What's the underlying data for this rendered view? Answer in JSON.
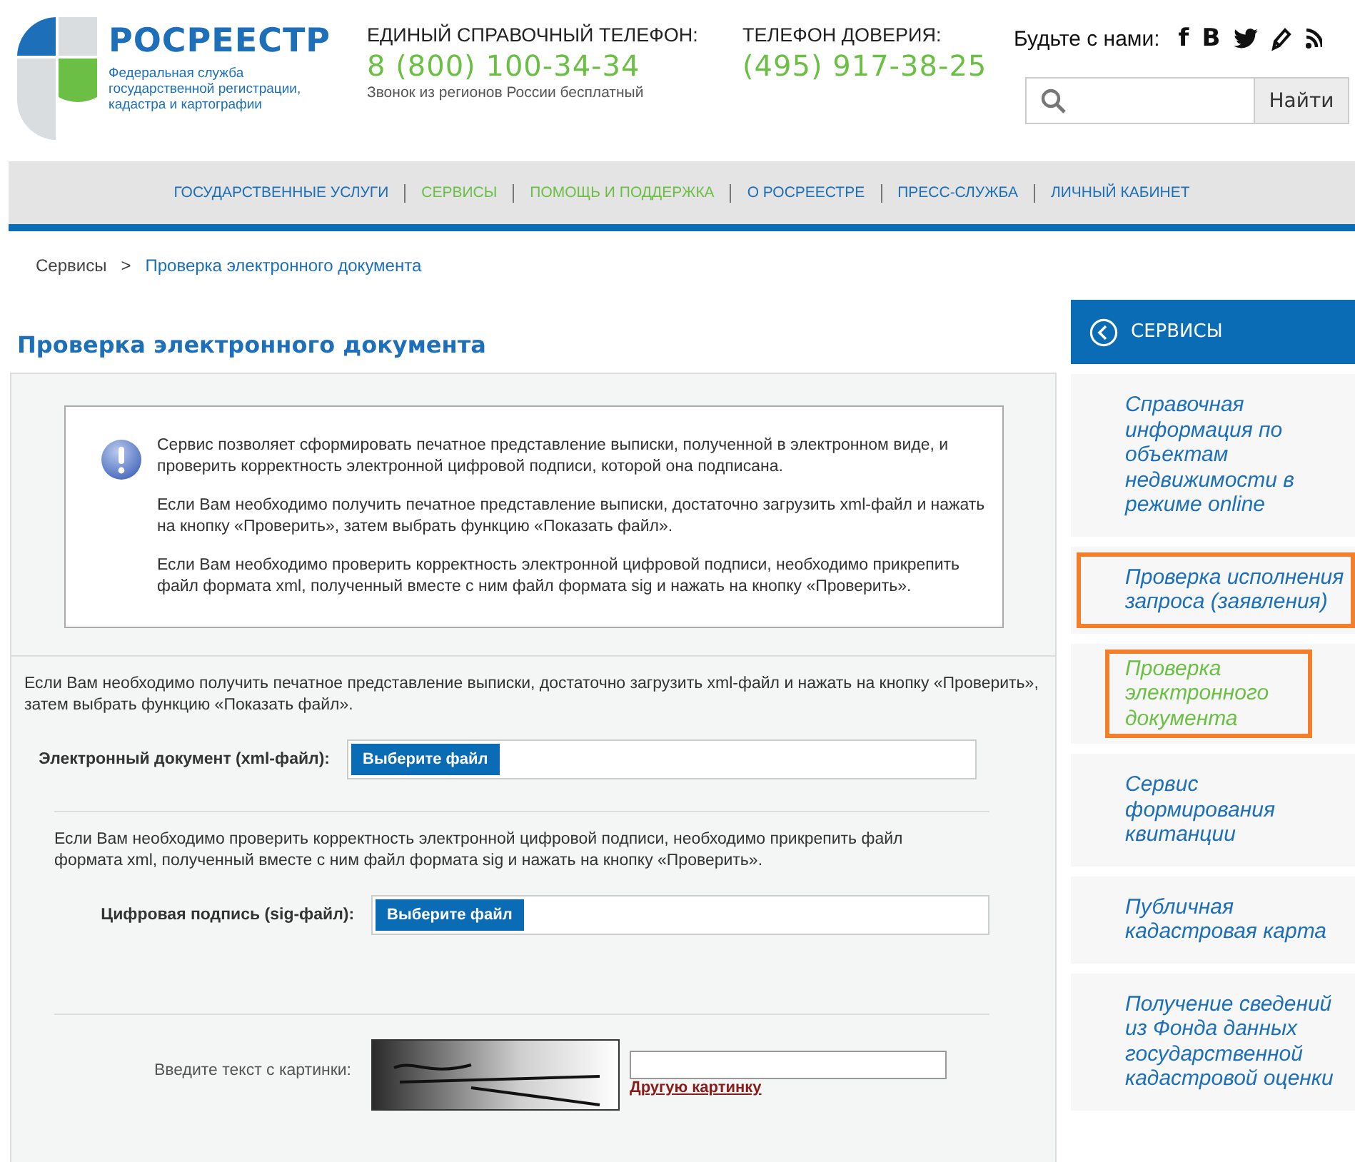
{
  "header": {
    "logo": {
      "title": "РОСРЕЕСТР",
      "subtitle": [
        "Федеральная служба",
        "государственной регистрации,",
        "кадастра и картографии"
      ]
    },
    "phones": [
      {
        "label": "ЕДИНЫЙ СПРАВОЧНЫЙ ТЕЛЕФОН:",
        "number": "8 (800) 100-34-34",
        "note": "Звонок из регионов России бесплатный"
      },
      {
        "label": "ТЕЛЕФОН ДОВЕРИЯ:",
        "number": "(495) 917-38-25"
      }
    ],
    "social": {
      "label": "Будьте с нами:",
      "icons": [
        {
          "kind": "glyph",
          "glyph": "f"
        },
        {
          "kind": "glyph",
          "glyph": "В"
        },
        {
          "kind": "bird"
        },
        {
          "kind": "pencil"
        },
        {
          "kind": "rss"
        }
      ]
    },
    "search": {
      "button": "Найти"
    }
  },
  "nav": [
    {
      "label": "ГОСУДАРСТВЕННЫЕ УСЛУГИ",
      "selected": false
    },
    {
      "label": "СЕРВИСЫ",
      "selected": true
    },
    {
      "label": "ПОМОЩЬ И ПОДДЕРЖКА",
      "selected": true
    },
    {
      "label": "О РОСРЕЕСТРЕ",
      "selected": false
    },
    {
      "label": "ПРЕСС-СЛУЖБА",
      "selected": false
    },
    {
      "label": "ЛИЧНЫЙ КАБИНЕТ",
      "selected": false
    }
  ],
  "breadcrumb": {
    "separator": ">",
    "items": [
      {
        "label": "Сервисы",
        "current": false
      },
      {
        "label": "Проверка электронного документа",
        "current": true
      }
    ]
  },
  "page_title": "Проверка электронного документа",
  "info_box": [
    "Сервис позволяет сформировать печатное представление выписки, полученной в электронном виде, и проверить корректность электронной цифровой подписи, которой она подписана.",
    "Если Вам необходимо получить печатное представление выписки, достаточно загрузить xml-файл и нажать на кнопку «Проверить», затем выбрать функцию «Показать файл».",
    "Если Вам необходимо проверить корректность электронной цифровой подписи, необходимо прикрепить файл формата xml, полученный вместе с ним файл формата sig и нажать на кнопку «Проверить»."
  ],
  "sections": [
    {
      "text": "Если Вам необходимо получить печатное представление выписки, достаточно загрузить xml-файл и нажать на кнопку «Проверить», затем выбрать функцию «Показать файл».",
      "label": "Электронный документ (xml-файл):",
      "button": "Выберите файл"
    },
    {
      "text": "Если Вам необходимо проверить корректность электронной цифровой подписи, необходимо прикрепить файл формата xml, полученный вместе с ним файл формата sig и нажать на кнопку «Проверить».",
      "label": "Цифровая подпись (sig-файл):",
      "button": "Выберите файл"
    }
  ],
  "captcha": {
    "label": "Введите текст с картинки:",
    "link": "Другую картинку"
  },
  "sidebar": {
    "title": "СЕРВИСЫ",
    "items": [
      {
        "label": "Справочная информация по объектам недвижимости в режиме online",
        "selected": false,
        "highlighted": false
      },
      {
        "label": "Проверка исполнения запроса (заявления)",
        "selected": false,
        "highlighted": true
      },
      {
        "label": "Проверка электронного документа",
        "selected": true,
        "highlighted": true
      },
      {
        "label": "Сервис формирования квитанции",
        "selected": false,
        "highlighted": false
      },
      {
        "label": "Публичная кадастровая карта",
        "selected": false,
        "highlighted": false
      },
      {
        "label": "Получение сведений из Фонда данных государственной кадастровой оценки",
        "selected": false,
        "highlighted": false
      }
    ]
  }
}
